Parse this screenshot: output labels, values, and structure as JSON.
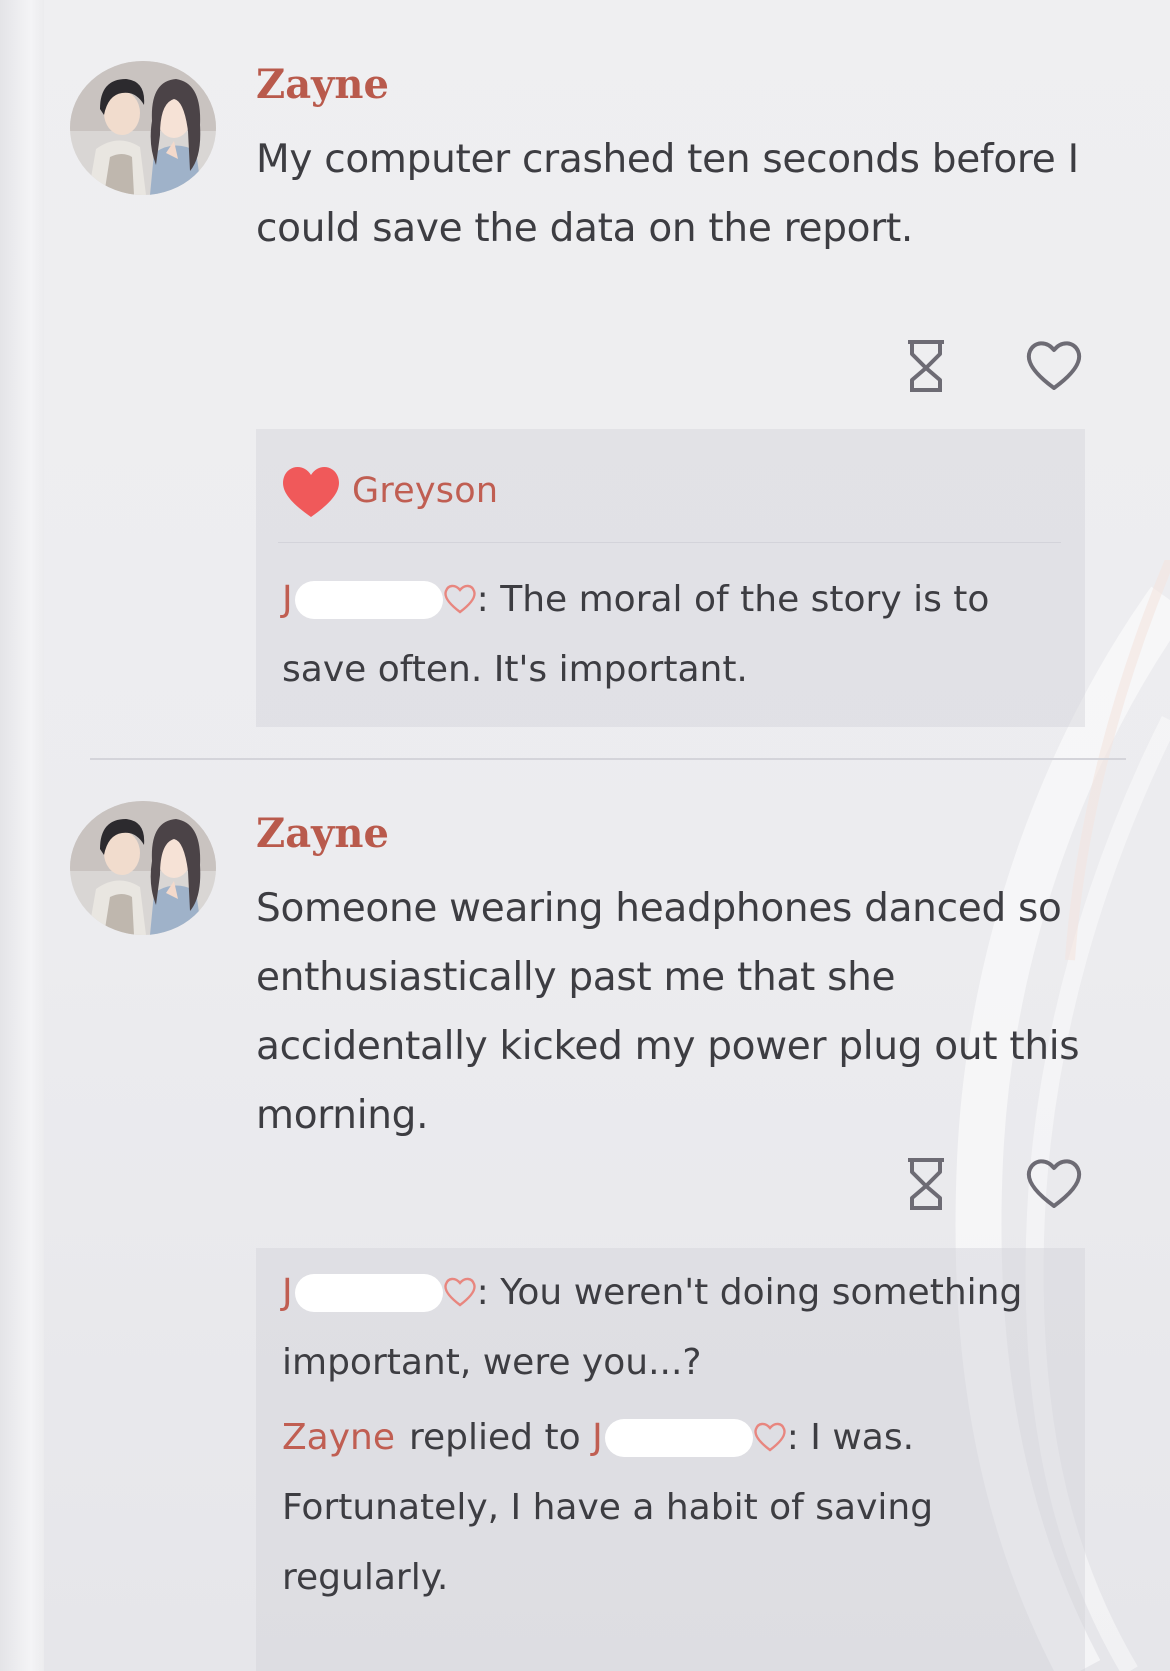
{
  "posts": [
    {
      "author": "Zayne",
      "text": "My computer crashed ten seconds before I could save the data on the report.",
      "actions": {
        "hourglass_icon": "hourglass-icon",
        "like_icon": "heart-outline-icon"
      },
      "likes": {
        "icon": "heart-filled-icon",
        "names": "Greyson"
      },
      "comments": [
        {
          "commenter_initial": "J",
          "commenter_suffix_icon": "heart-outline-small-icon",
          "text": ": The moral of the story is to save often. It's important."
        }
      ]
    },
    {
      "author": "Zayne",
      "text": "Someone wearing headphones danced so enthusiastically past me that she accidentally kicked my power plug out this morning.",
      "actions": {
        "hourglass_icon": "hourglass-icon",
        "like_icon": "heart-outline-icon"
      },
      "comments": [
        {
          "commenter_initial": "J",
          "text": ": You weren't doing something important, were you...?"
        },
        {
          "reply_author": "Zayne",
          "replied_to_label": "replied to",
          "reply_target_initial": "J",
          "text": ": I was. Fortunately, I have a habit of saving regularly."
        }
      ]
    }
  ],
  "colors": {
    "accent": "#c05e52",
    "author": "#b95a4c",
    "heart_fill": "#f0595a",
    "background": "#ececef",
    "reply_bg": "#dedee4"
  }
}
